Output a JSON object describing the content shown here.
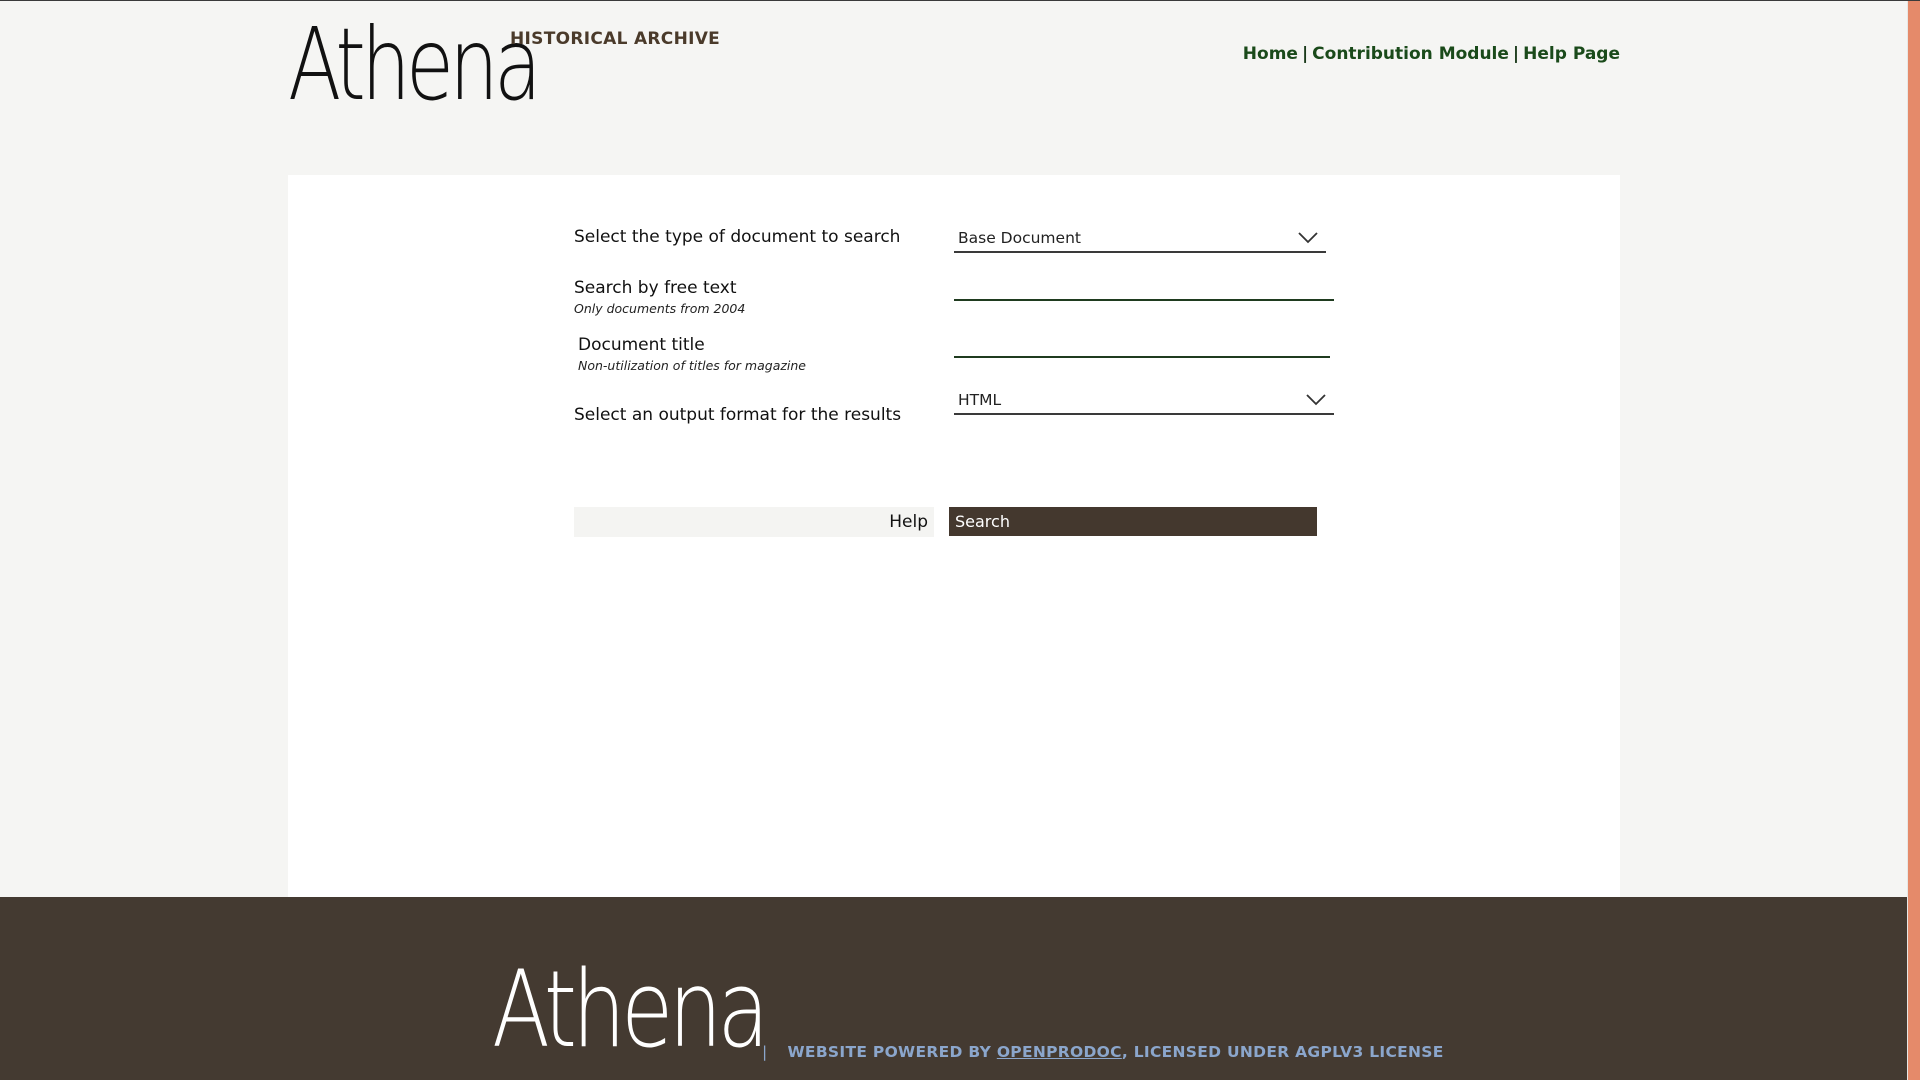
{
  "header": {
    "logo_text": "Athena",
    "archive_title": "HISTORICAL ARCHIVE",
    "nav": {
      "home": "Home",
      "contribution": "Contribution Module",
      "help": "Help Page",
      "separator": "|"
    }
  },
  "form": {
    "doc_type": {
      "label": "Select the type of document to search",
      "selected": "Base Document"
    },
    "free_text": {
      "label": "Search by free text",
      "hint": "Only documents from 2004",
      "value": ""
    },
    "doc_title": {
      "label": "Document title",
      "hint": "Non-utilization of titles for magazine",
      "value": ""
    },
    "output_format": {
      "label": "Select an output format for the results",
      "selected": "HTML"
    },
    "help_label": "Help",
    "search_label": "Search"
  },
  "footer": {
    "logo_text": "Athena",
    "pipe": "|",
    "powered_by": "WEBSITE POWERED BY ",
    "link_text": "OPENPRODOC",
    "license": ", LICENSED UNDER AGPLV3 LICENSE"
  },
  "colors": {
    "page_bg": "#f5f5f3",
    "footer_bg": "#443a31",
    "search_button_bg": "#44382e",
    "nav_link": "#1a4a1a",
    "footer_text": "#8ba6cc",
    "accent_strip": "#e58a6a"
  },
  "icons": {
    "select_arrow": "chevron-down-icon"
  }
}
